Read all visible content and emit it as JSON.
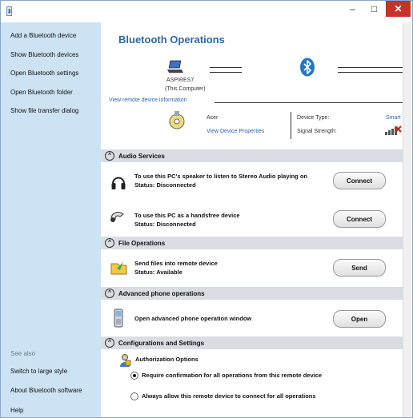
{
  "window": {
    "min_label": "–",
    "max_label": "□",
    "close_label": "✕"
  },
  "sidebar": {
    "items": [
      {
        "label": "Add a Bluetooth device"
      },
      {
        "label": "Show Bluetooth devices"
      },
      {
        "label": "Open Bluetooth settings"
      },
      {
        "label": "Open Bluetooth folder"
      },
      {
        "label": "Show file transfer dialog"
      }
    ],
    "see_also": "See also",
    "see_also_items": [
      {
        "label": "Switch to large style"
      },
      {
        "label": "About Bluetooth software"
      },
      {
        "label": "Help"
      }
    ]
  },
  "header": {
    "title": "Bluetooth Operations",
    "computer_name": "ASPIRES7",
    "computer_sub": "(This Computer)",
    "remote_info_link": "View remote device information",
    "device_name": "Acer",
    "view_properties_link": "View Device Properties",
    "device_type_label": "Device Type:",
    "device_type_value": "Smart",
    "signal_strength_label": "Signal Strength:"
  },
  "sections": {
    "audio": {
      "title": "Audio Services",
      "row1_text": "To use this PC's speaker to listen to Stereo Audio playing on",
      "row1_status": "Status:  Disconnected",
      "row1_button": "Connect",
      "row2_text": "To use this PC as a handsfree device",
      "row2_status": "Status:  Disconnected",
      "row2_button": "Connect"
    },
    "file": {
      "title": "File Operations",
      "row_text": "Send files into remote device",
      "row_status": "Status:  Available",
      "row_button": "Send"
    },
    "phone": {
      "title": "Advanced phone operations",
      "row_text": "Open advanced phone operation window",
      "row_button": "Open"
    },
    "config": {
      "title": "Configurations and Settings",
      "auth_title": "Authorization Options",
      "option1": "Require confirmation for all operations from this remote device",
      "option2": "Always allow this remote device to connect for all operations"
    }
  },
  "colors": {
    "sidebar_bg": "#cde3f3",
    "title_blue": "#2a6aa8",
    "link_blue": "#2d65b0",
    "section_bar": "#d9dde3",
    "close_red": "#c9302c"
  },
  "icons": [
    "bluetooth-app-icon",
    "laptop-icon",
    "bluetooth-icon",
    "device-settings-icon",
    "signal-strength-icon",
    "headphones-icon",
    "handsfree-icon",
    "send-files-icon",
    "phone-icon",
    "authorization-icon"
  ]
}
